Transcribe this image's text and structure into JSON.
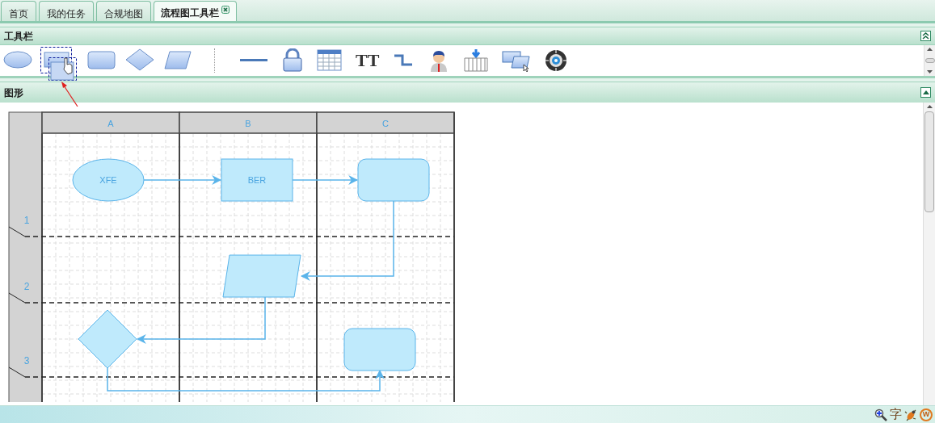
{
  "tabs": [
    {
      "label": "首页",
      "selected": false,
      "closable": false
    },
    {
      "label": "我的任务",
      "selected": false,
      "closable": false
    },
    {
      "label": "合规地图",
      "selected": false,
      "closable": false
    },
    {
      "label": "流程图工具栏",
      "selected": true,
      "closable": true
    }
  ],
  "toolbar_panel": {
    "title": "工具栏",
    "tools": [
      {
        "kind": "ellipse",
        "dragging": false
      },
      {
        "kind": "rect",
        "dragging": true
      },
      {
        "kind": "rounded",
        "dragging": false
      },
      {
        "kind": "diamond",
        "dragging": false
      },
      {
        "kind": "parallelogram",
        "dragging": false
      },
      {
        "kind": "separator"
      },
      {
        "kind": "line",
        "dragging": false
      },
      {
        "kind": "lock",
        "dragging": false
      },
      {
        "kind": "table",
        "dragging": false
      },
      {
        "kind": "text",
        "label": "TT",
        "dragging": false
      },
      {
        "kind": "elbow",
        "dragging": false
      },
      {
        "kind": "person",
        "dragging": false
      },
      {
        "kind": "pool",
        "dragging": false
      },
      {
        "kind": "windows",
        "dragging": false
      },
      {
        "kind": "target",
        "dragging": false
      }
    ]
  },
  "shapes_panel": {
    "title": "图形",
    "diagram": {
      "columns": [
        "A",
        "B",
        "C"
      ],
      "rows": [
        "1",
        "2",
        "3"
      ],
      "nodes": [
        {
          "kind": "ellipse",
          "text": "XFE"
        },
        {
          "kind": "rect",
          "text": "BER"
        },
        {
          "kind": "rounded"
        },
        {
          "kind": "parallelogram"
        },
        {
          "kind": "diamond"
        },
        {
          "kind": "rounded"
        }
      ]
    }
  },
  "status_bar": {
    "icons": [
      {
        "kind": "zoom"
      },
      {
        "kind": "char",
        "text": "字"
      },
      {
        "kind": "bug"
      },
      {
        "kind": "badge",
        "text": "W"
      }
    ]
  }
}
